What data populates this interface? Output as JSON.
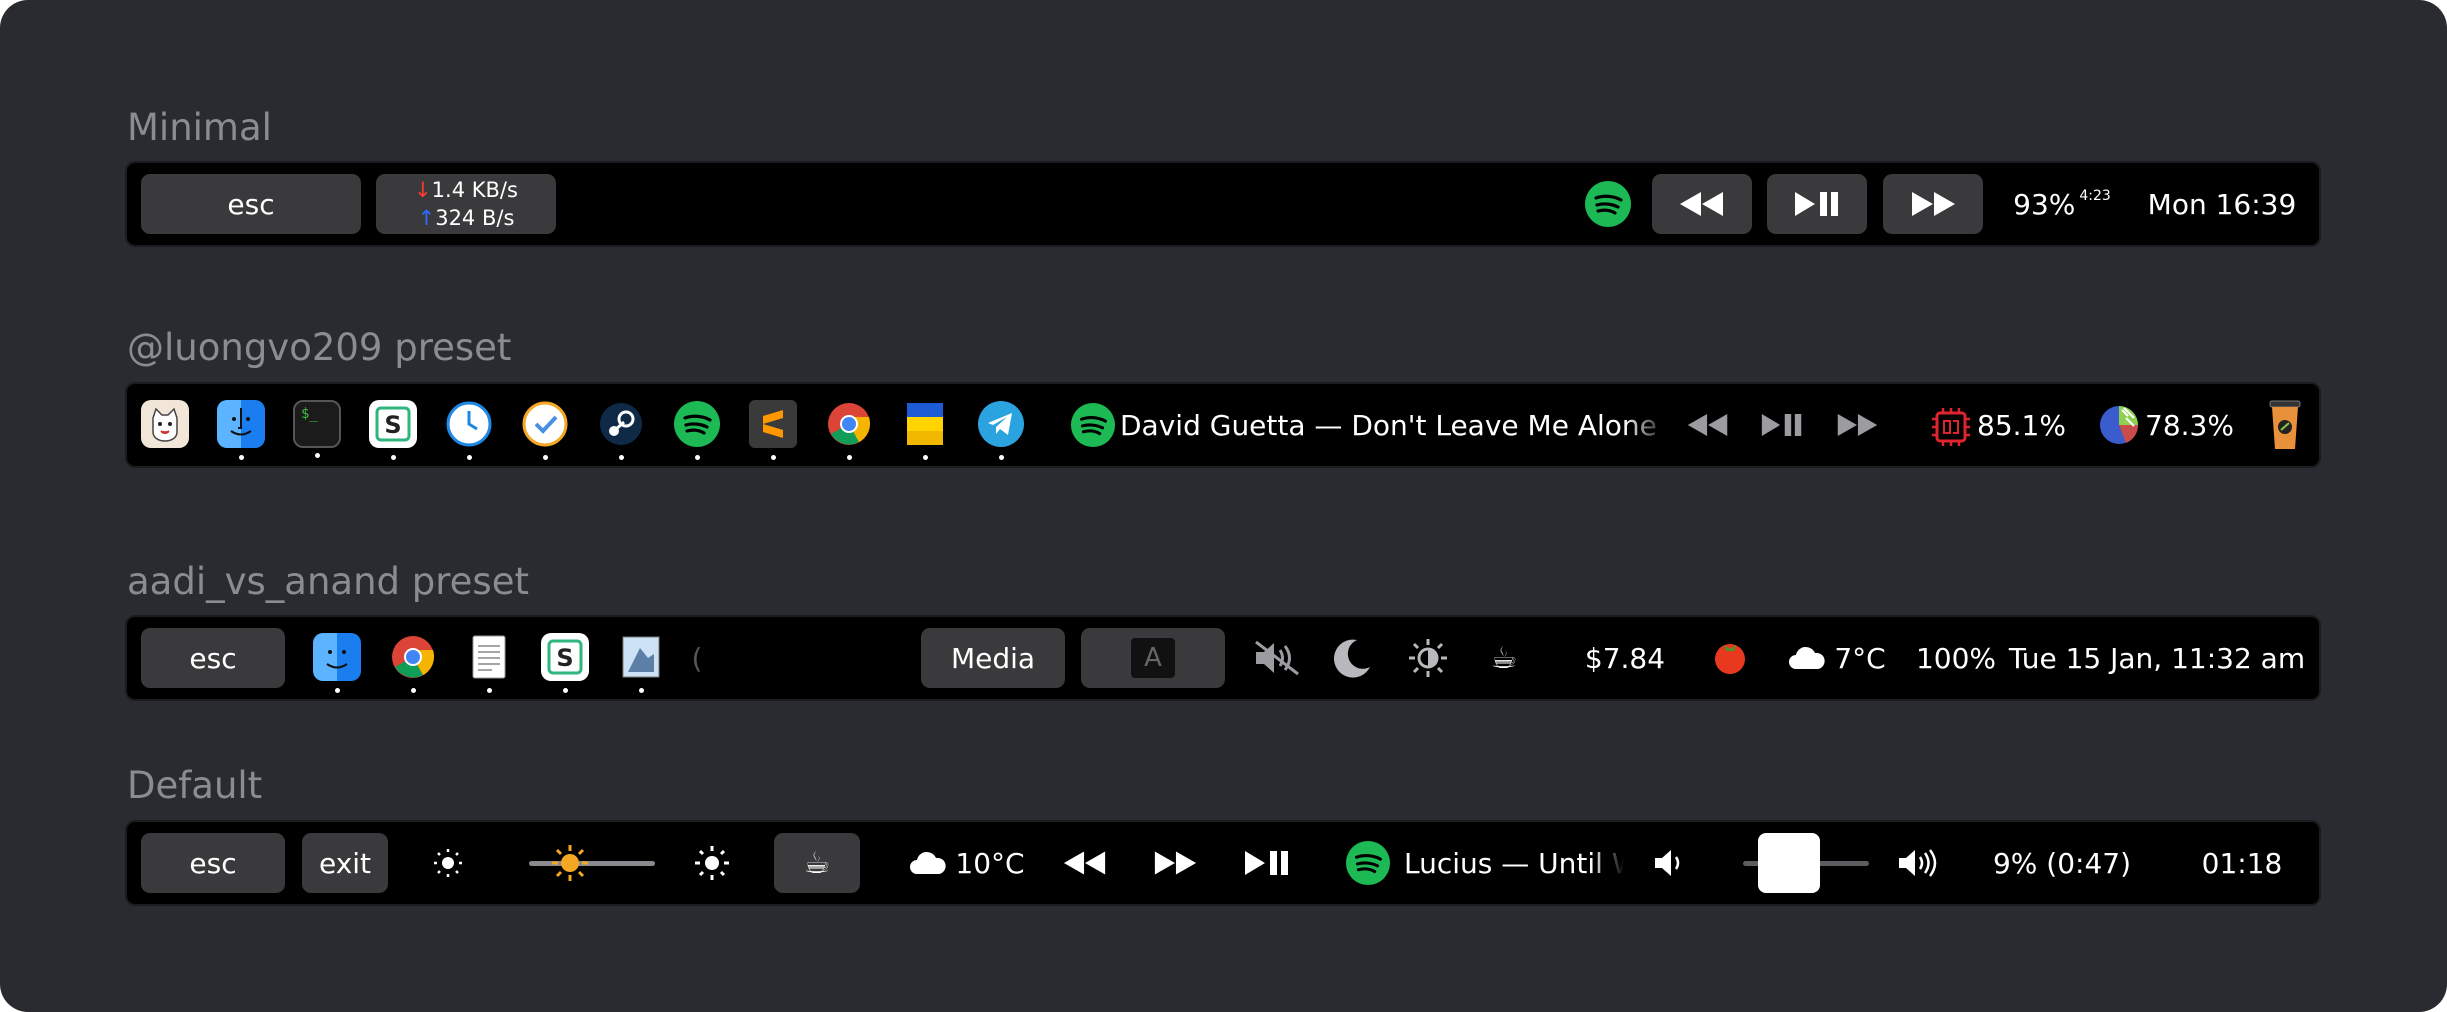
{
  "sections": {
    "minimal": "Minimal",
    "luongvo": "@luongvo209 preset",
    "aadi": "aadi_vs_anand preset",
    "default": "Default"
  },
  "minimal": {
    "esc": "esc",
    "net_down": "1.4 KB/s",
    "net_up": "324 B/s",
    "battery": "93%",
    "battery_time": "4:23",
    "clock": "Mon 16:39"
  },
  "luongvo": {
    "now_playing": "David Guetta — Don't Leave Me Alone (feat. Anne-Marie)",
    "cpu": "85.1%",
    "memory": "78.3%"
  },
  "aadi": {
    "esc": "esc",
    "media": "Media",
    "input_source": "A",
    "stock": "$7.84",
    "weather": "7°C",
    "battery": "100%",
    "datetime": "Tue 15 Jan, 11:32 am"
  },
  "default": {
    "esc": "esc",
    "exit": "exit",
    "weather": "10°C",
    "now_playing": "Lucius — Until We Get There",
    "battery": "9% (0:47)",
    "clock": "01:18",
    "brightness_level": 0.25,
    "volume_level": 0.25
  },
  "colors": {
    "canvas": "#2a2b30",
    "bar": "#000000",
    "button": "#3a3a3c",
    "spotify": "#1db954",
    "title": "#8b8c91"
  }
}
